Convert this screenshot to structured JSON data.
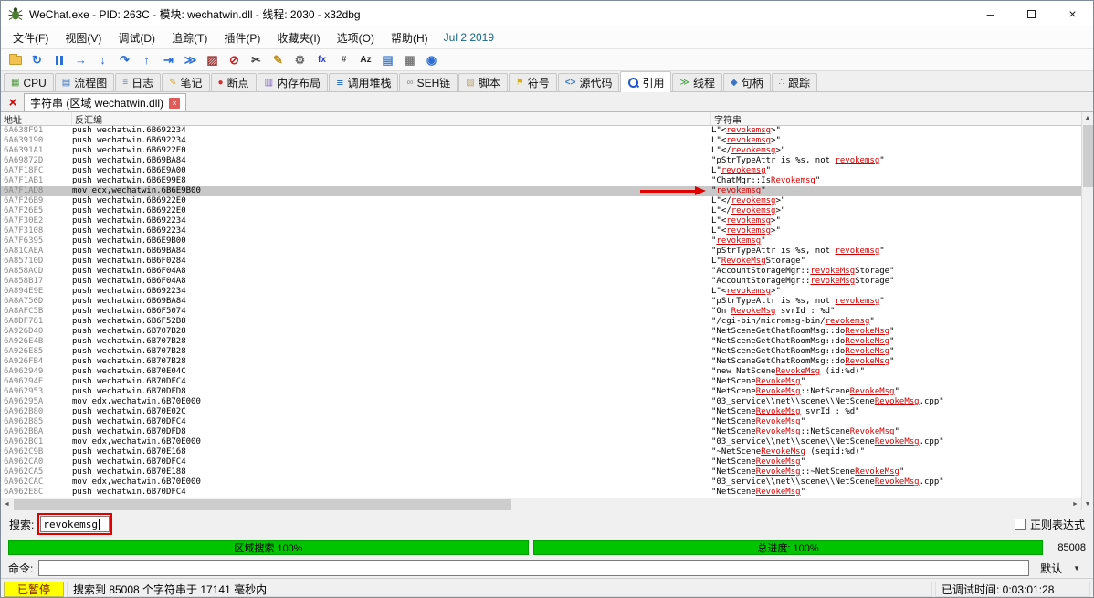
{
  "window": {
    "title": "WeChat.exe - PID: 263C - 模块: wechatwin.dll - 线程: 2030 - x32dbg"
  },
  "menu": {
    "items": [
      "文件(F)",
      "视图(V)",
      "调试(D)",
      "追踪(T)",
      "插件(P)",
      "收藏夹(I)",
      "选项(O)",
      "帮助(H)"
    ],
    "build_date": "Jul 2 2019"
  },
  "toolbar": {
    "icons": [
      {
        "id": "open-file",
        "type": "folder",
        "glyph": "",
        "color": "#F2C14E"
      },
      {
        "id": "restart",
        "type": "glyph",
        "glyph": "↻",
        "color": "#2B6FD4"
      },
      {
        "id": "pause",
        "type": "pause",
        "glyph": "",
        "color": "#2B6FD4"
      },
      {
        "id": "run",
        "type": "glyph",
        "glyph": "→",
        "color": "#2B6FD4"
      },
      {
        "id": "step-into",
        "type": "glyph",
        "glyph": "↓",
        "color": "#2B6FD4"
      },
      {
        "id": "step-over",
        "type": "glyph",
        "glyph": "↷",
        "color": "#2B6FD4"
      },
      {
        "id": "step-out",
        "type": "glyph",
        "glyph": "↑",
        "color": "#2B6FD4"
      },
      {
        "id": "run-to-cursor",
        "type": "glyph",
        "glyph": "⇥",
        "color": "#2B6FD4"
      },
      {
        "id": "animate",
        "type": "glyph",
        "glyph": "≫",
        "color": "#2B6FD4"
      },
      {
        "id": "patch",
        "type": "glyph",
        "glyph": "▨",
        "color": "#993333"
      },
      {
        "id": "stop",
        "type": "glyph",
        "glyph": "⊘",
        "color": "#CC2222"
      },
      {
        "id": "scissors",
        "type": "glyph",
        "glyph": "✂",
        "color": "#444444"
      },
      {
        "id": "pencil",
        "type": "glyph",
        "glyph": "✎",
        "color": "#C09020"
      },
      {
        "id": "settings-gear",
        "type": "glyph",
        "glyph": "⚙",
        "color": "#666666"
      },
      {
        "id": "calculator",
        "type": "text",
        "glyph": "fx",
        "color": "#2B3FC0"
      },
      {
        "id": "hash",
        "type": "text",
        "glyph": "#",
        "color": "#444444"
      },
      {
        "id": "font",
        "type": "text",
        "glyph": "Az",
        "color": "#222222"
      },
      {
        "id": "notes-doc",
        "type": "glyph",
        "glyph": "▤",
        "color": "#4080D0"
      },
      {
        "id": "grid",
        "type": "glyph",
        "glyph": "▦",
        "color": "#7A7A7A"
      },
      {
        "id": "browser",
        "type": "glyph",
        "glyph": "◉",
        "color": "#2B6FD4"
      }
    ]
  },
  "tabs": {
    "selected": "references",
    "items": [
      {
        "id": "cpu",
        "label": "CPU",
        "icon": "cpu-icon",
        "icon_type": "glyph",
        "glyph": "▦",
        "color": "#4E9A3C"
      },
      {
        "id": "graph",
        "label": "流程图",
        "icon": "graph-icon",
        "icon_type": "glyph",
        "glyph": "▤",
        "color": "#3A76C4"
      },
      {
        "id": "log",
        "label": "日志",
        "icon": "log-icon",
        "icon_type": "glyph",
        "glyph": "≡",
        "color": "#5A8AC0"
      },
      {
        "id": "notes",
        "label": "笔记",
        "icon": "notes-icon",
        "icon_type": "glyph",
        "glyph": "✎",
        "color": "#D9A520"
      },
      {
        "id": "breakpoints",
        "label": "断点",
        "icon": "breakpoint-icon",
        "icon_type": "glyph",
        "glyph": "●",
        "color": "#D03030"
      },
      {
        "id": "memory-map",
        "label": "内存布局",
        "icon": "memory-map-icon",
        "icon_type": "glyph",
        "glyph": "▥",
        "color": "#7A5AC0"
      },
      {
        "id": "call-stack",
        "label": "调用堆栈",
        "icon": "call-stack-icon",
        "icon_type": "glyph",
        "glyph": "≣",
        "color": "#2F6FBF"
      },
      {
        "id": "seh-chain",
        "label": "SEH链",
        "icon": "seh-chain-icon",
        "icon_type": "glyph",
        "glyph": "∞",
        "color": "#8A8A8A"
      },
      {
        "id": "script",
        "label": "脚本",
        "icon": "script-icon",
        "icon_type": "glyph",
        "glyph": "▧",
        "color": "#C0A060"
      },
      {
        "id": "symbols",
        "label": "符号",
        "icon": "symbols-icon",
        "icon_type": "glyph",
        "glyph": "⚑",
        "color": "#E0B000"
      },
      {
        "id": "source",
        "label": "源代码",
        "icon": "source-icon",
        "icon_type": "text",
        "glyph": "<>",
        "color": "#3A76C4"
      },
      {
        "id": "references",
        "label": "引用",
        "icon": "references-icon",
        "icon_type": "mag",
        "glyph": "",
        "color": "#2255CC"
      },
      {
        "id": "threads",
        "label": "线程",
        "icon": "threads-icon",
        "icon_type": "glyph",
        "glyph": "≫",
        "color": "#3A9A3A"
      },
      {
        "id": "handles",
        "label": "句柄",
        "icon": "handles-icon",
        "icon_type": "glyph",
        "glyph": "◆",
        "color": "#3A76C4"
      },
      {
        "id": "trace",
        "label": "跟踪",
        "icon": "trace-icon",
        "icon_type": "glyph",
        "glyph": "∴",
        "color": "#996633"
      }
    ]
  },
  "subtab": {
    "label": "字符串 (区域 wechatwin.dll)"
  },
  "table": {
    "columns": [
      "地址",
      "反汇编",
      "字符串"
    ],
    "selected_index": 6,
    "rows": [
      [
        "6A638F91",
        "push wechatwin.6B692234",
        "L\"<revokemsg>\""
      ],
      [
        "6A639190",
        "push wechatwin.6B692234",
        "L\"<revokemsg>\""
      ],
      [
        "6A6391A1",
        "push wechatwin.6B6922E0",
        "L\"</revokemsg>\""
      ],
      [
        "6A69872D",
        "push wechatwin.6B69BA84",
        "\"pStrTypeAttr is %s, not revokemsg\""
      ],
      [
        "6A7F18FC",
        "push wechatwin.6B6E9A00",
        "L\"revokemsg\""
      ],
      [
        "6A7F1AB1",
        "push wechatwin.6B6E99E8",
        "\"ChatMgr::IsRevokemsg\""
      ],
      [
        "6A7F1AD8",
        "mov ecx,wechatwin.6B6E9B00",
        "\"revokemsg\""
      ],
      [
        "6A7F26B9",
        "push wechatwin.6B6922E0",
        "L\"</revokemsg>\""
      ],
      [
        "6A7F26E5",
        "push wechatwin.6B6922E0",
        "L\"</revokemsg>\""
      ],
      [
        "6A7F30E2",
        "push wechatwin.6B692234",
        "L\"<revokemsg>\""
      ],
      [
        "6A7F3108",
        "push wechatwin.6B692234",
        "L\"<revokemsg>\""
      ],
      [
        "6A7F6395",
        "push wechatwin.6B6E9B00",
        "\"revokemsg\""
      ],
      [
        "6A81CAEA",
        "push wechatwin.6B69BA84",
        "\"pStrTypeAttr is %s, not revokemsg\""
      ],
      [
        "6A85710D",
        "push wechatwin.6B6F0284",
        "L\"RevokeMsgStorage\""
      ],
      [
        "6A858ACD",
        "push wechatwin.6B6F04A8",
        "\"AccountStorageMgr::revokeMsgStorage\""
      ],
      [
        "6A858B17",
        "push wechatwin.6B6F04A8",
        "\"AccountStorageMgr::revokeMsgStorage\""
      ],
      [
        "6A894E9E",
        "push wechatwin.6B692234",
        "L\"<revokemsg>\""
      ],
      [
        "6A8A750D",
        "push wechatwin.6B69BA84",
        "\"pStrTypeAttr is %s, not revokemsg\""
      ],
      [
        "6A8AFC5B",
        "push wechatwin.6B6F5074",
        "\"On RevokeMsg svrId : %d\""
      ],
      [
        "6A8DF781",
        "push wechatwin.6B6F52B8",
        "\"/cgi-bin/micromsg-bin/revokemsg\""
      ],
      [
        "6A926D40",
        "push wechatwin.6B707B28",
        "\"NetSceneGetChatRoomMsg::doRevokeMsg\""
      ],
      [
        "6A926E4B",
        "push wechatwin.6B707B28",
        "\"NetSceneGetChatRoomMsg::doRevokeMsg\""
      ],
      [
        "6A926E85",
        "push wechatwin.6B707B28",
        "\"NetSceneGetChatRoomMsg::doRevokeMsg\""
      ],
      [
        "6A926FB4",
        "push wechatwin.6B707B28",
        "\"NetSceneGetChatRoomMsg::doRevokeMsg\""
      ],
      [
        "6A962949",
        "push wechatwin.6B70E04C",
        "\"new NetSceneRevokeMsg (id:%d)\""
      ],
      [
        "6A96294E",
        "push wechatwin.6B70DFC4",
        "\"NetSceneRevokeMsg\""
      ],
      [
        "6A962953",
        "push wechatwin.6B70DFD8",
        "\"NetSceneRevokeMsg::NetSceneRevokeMsg\""
      ],
      [
        "6A96295A",
        "mov edx,wechatwin.6B70E000",
        "\"03_service\\\\net\\\\scene\\\\NetSceneRevokeMsg.cpp\""
      ],
      [
        "6A962B80",
        "push wechatwin.6B70E02C",
        "\"NetSceneRevokeMsg svrId : %d\""
      ],
      [
        "6A962B85",
        "push wechatwin.6B70DFC4",
        "\"NetSceneRevokeMsg\""
      ],
      [
        "6A962BBA",
        "push wechatwin.6B70DFD8",
        "\"NetSceneRevokeMsg::NetSceneRevokeMsg\""
      ],
      [
        "6A962BC1",
        "mov edx,wechatwin.6B70E000",
        "\"03_service\\\\net\\\\scene\\\\NetSceneRevokeMsg.cpp\""
      ],
      [
        "6A962C9B",
        "push wechatwin.6B70E168",
        "\"~NetSceneRevokeMsg (seqid:%d)\""
      ],
      [
        "6A962CA0",
        "push wechatwin.6B70DFC4",
        "\"NetSceneRevokeMsg\""
      ],
      [
        "6A962CA5",
        "push wechatwin.6B70E188",
        "\"NetSceneRevokeMsg::~NetSceneRevokeMsg\""
      ],
      [
        "6A962CAC",
        "mov edx,wechatwin.6B70E000",
        "\"03_service\\\\net\\\\scene\\\\NetSceneRevokeMsg.cpp\""
      ],
      [
        "6A962E8C",
        "push wechatwin.6B70DFC4",
        "\"NetSceneRevokeMsg\""
      ]
    ]
  },
  "search": {
    "label": "搜索:",
    "value": "revokemsg",
    "regex_label": "正则表达式",
    "regex_checked": false
  },
  "progress": {
    "region_label": "区域搜索 100%",
    "total_label": "总进度: 100%",
    "count": "85008"
  },
  "command": {
    "label": "命令:",
    "value": "",
    "profile": "默认"
  },
  "status": {
    "state": "已暂停",
    "message": "搜索到 85008 个字符串于 17141 毫秒内",
    "debug_time": "已调试时间: 0:03:01:28"
  },
  "colors": {
    "match_highlight": "#D40000",
    "selection": "#C8C8C8",
    "progress_green": "#00C400",
    "paused_badge": "#FFFF00",
    "annotation_red": "#E00000"
  }
}
